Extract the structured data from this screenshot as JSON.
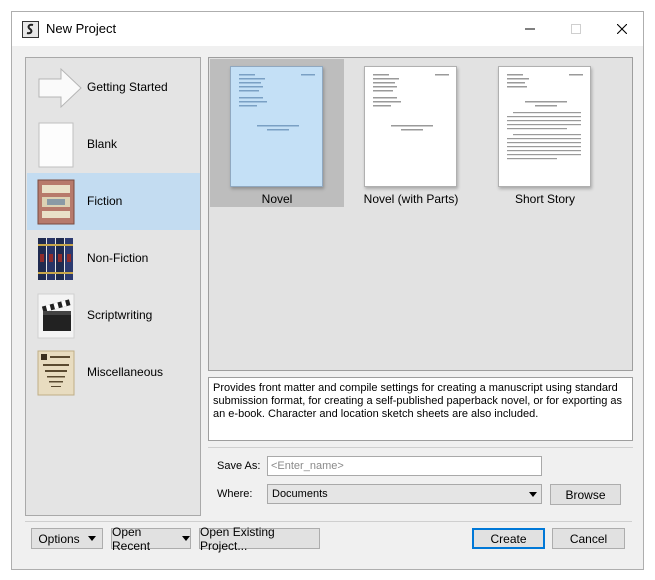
{
  "window": {
    "title": "New Project",
    "controls": [
      "minimize-icon",
      "maximize-icon",
      "close-icon"
    ]
  },
  "sidebar": {
    "items": [
      {
        "label": "Getting Started",
        "icon": "arrow-icon",
        "selected": false
      },
      {
        "label": "Blank",
        "icon": "blank-page-icon",
        "selected": false
      },
      {
        "label": "Fiction",
        "icon": "fiction-book-icon",
        "selected": true
      },
      {
        "label": "Non-Fiction",
        "icon": "books-icon",
        "selected": false
      },
      {
        "label": "Scriptwriting",
        "icon": "clapperboard-icon",
        "selected": false
      },
      {
        "label": "Miscellaneous",
        "icon": "eye-chart-icon",
        "selected": false
      }
    ]
  },
  "templates": [
    {
      "label": "Novel",
      "selected": true
    },
    {
      "label": "Novel (with Parts)",
      "selected": false
    },
    {
      "label": "Short Story",
      "selected": false
    }
  ],
  "description": "Provides front matter and compile settings for creating a manuscript using standard submission format, for creating a self-published paperback novel, or for exporting as an e-book. Character and location sketch sheets are also included.",
  "form": {
    "save_as_label": "Save As:",
    "save_as_placeholder": "<Enter_name>",
    "where_label": "Where:",
    "where_value": "Documents",
    "browse_label": "Browse"
  },
  "footer": {
    "options_label": "Options",
    "open_recent_label": "Open Recent",
    "open_existing_label": "Open Existing Project...",
    "create_label": "Create",
    "cancel_label": "Cancel"
  },
  "colors": {
    "selected_sidebar": "#c3dcf1",
    "selected_template": "#bdbdbd",
    "default_button_border": "#0078d7"
  }
}
